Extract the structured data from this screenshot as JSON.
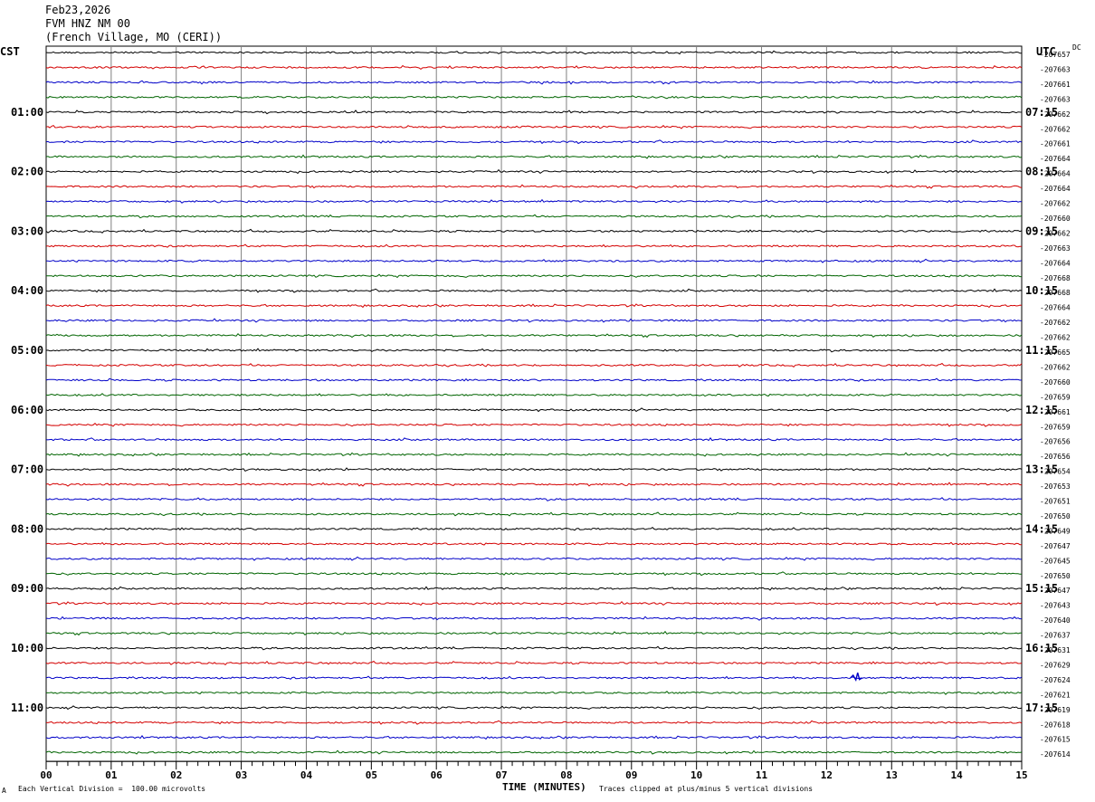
{
  "header": {
    "date": "Feb23,2026",
    "station": "FVM HNZ NM 00",
    "location": "(French Village, MO (CERI))"
  },
  "left_zone": "CST",
  "right_zone": "UTC",
  "dc_label": "DC",
  "footer": {
    "scale": "Each Vertical Division =  100.00 microvolts",
    "xlabel": "TIME (MINUTES)",
    "clip": "Traces clipped at plus/minus 5 vertical divisions",
    "mark": "A"
  },
  "colors": [
    "#000000",
    "#d40000",
    "#0000c8",
    "#006400"
  ],
  "chart_data": {
    "type": "line",
    "title": "FVM HNZ NM 00",
    "xlabel": "TIME (MINUTES)",
    "xlim": [
      0,
      15
    ],
    "x_ticks": [
      "00",
      "01",
      "02",
      "03",
      "04",
      "05",
      "06",
      "07",
      "08",
      "09",
      "10",
      "11",
      "12",
      "13",
      "14",
      "15"
    ],
    "left_time_labels": [
      "01:00",
      "02:00",
      "03:00",
      "04:00",
      "05:00",
      "06:00",
      "07:00",
      "08:00",
      "09:00",
      "10:00",
      "11:00"
    ],
    "right_time_labels": [
      "07:15",
      "08:15",
      "09:15",
      "10:15",
      "11:15",
      "12:15",
      "13:15",
      "14:15",
      "15:15",
      "16:15",
      "17:15"
    ],
    "traces_per_hour": 4,
    "trace_minutes": 15,
    "trace_count": 48,
    "dc_offsets": [
      "-207657",
      "-207663",
      "-207661",
      "-207663",
      "-207662",
      "-207662",
      "-207661",
      "-207664",
      "-207664",
      "-207664",
      "-207662",
      "-207660",
      "-207662",
      "-207663",
      "-207664",
      "-207668",
      "-207668",
      "-207664",
      "-207662",
      "-207662",
      "-207665",
      "-207662",
      "-207660",
      "-207659",
      "-207661",
      "-207659",
      "-207656",
      "-207656",
      "-207654",
      "-207653",
      "-207651",
      "-207650",
      "-207649",
      "-207647",
      "-207645",
      "-207650",
      "-207647",
      "-207643",
      "-207640",
      "-207637",
      "-207631",
      "-207629",
      "-207624",
      "-207621",
      "-207619",
      "-207618",
      "-207615",
      "-207614"
    ],
    "events": [
      {
        "trace_index": 42,
        "minute": 12.45,
        "amplitude": 0.35
      }
    ]
  }
}
